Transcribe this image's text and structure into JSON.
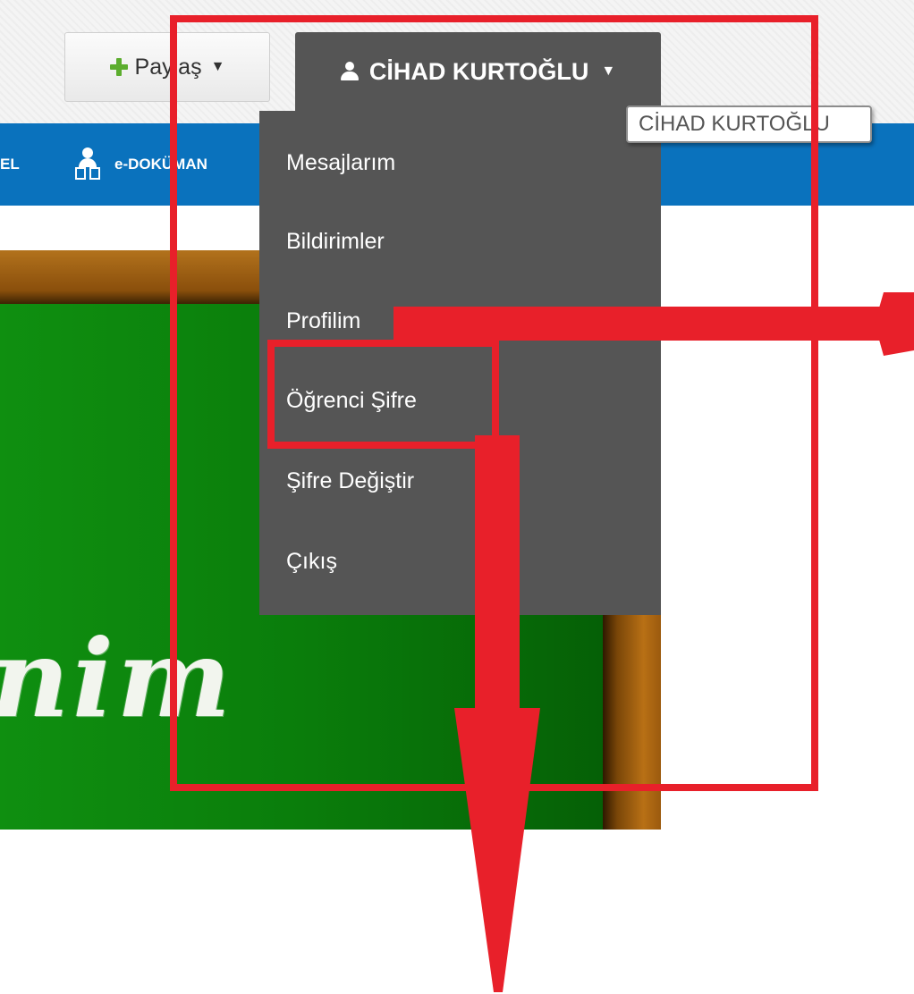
{
  "topbar": {
    "share_button": "Paylaş",
    "user_button": "CİHAD KURTOĞLU"
  },
  "tooltip": "CİHAD KURTOĞLU",
  "navbar": {
    "items": [
      {
        "label": "EL"
      },
      {
        "label": "e-DOKÜMAN",
        "icon": "user-documents-icon"
      }
    ]
  },
  "dropdown": {
    "items": [
      "Mesajlarım",
      "Bildirimler",
      "Profilim",
      "Öğrenci Şifre",
      "Şifre Değiştir",
      "Çıkış"
    ]
  },
  "banner": {
    "chalk_text": "nim"
  },
  "annotations": {
    "color": "#e8202a"
  }
}
